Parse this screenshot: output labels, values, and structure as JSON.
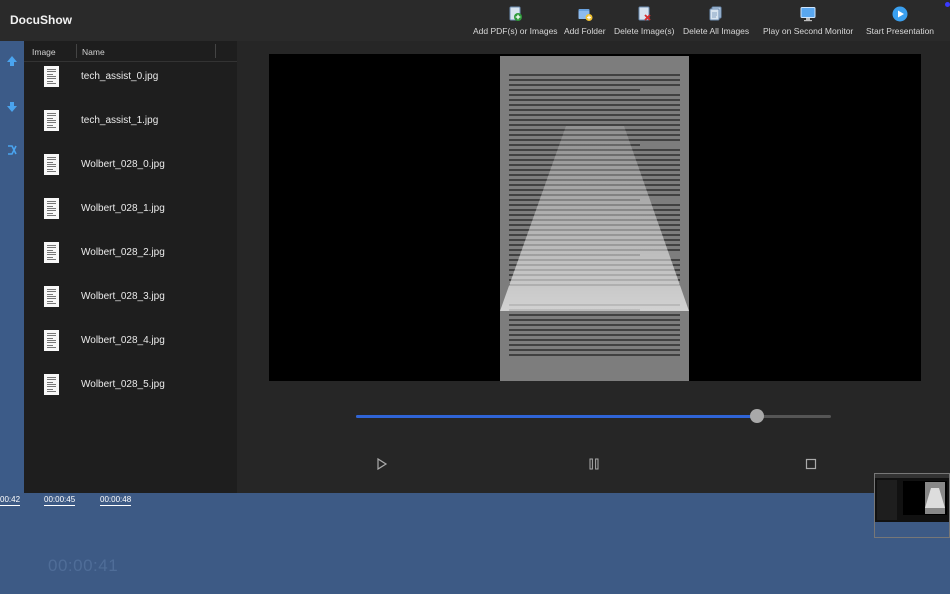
{
  "app": {
    "title": "DocuShow"
  },
  "toolbar": {
    "buttons": [
      {
        "label": "Add PDF(s) or Images",
        "icon": "add-file-icon"
      },
      {
        "label": "Add Folder",
        "icon": "add-folder-icon"
      },
      {
        "label": "Delete Image(s)",
        "icon": "delete-image-icon"
      },
      {
        "label": "Delete All Images",
        "icon": "delete-all-icon"
      },
      {
        "label": "Play on Second Monitor",
        "icon": "monitor-icon"
      },
      {
        "label": "Start Presentation",
        "icon": "play-circle-icon"
      }
    ]
  },
  "list": {
    "headers": {
      "image": "Image",
      "name": "Name"
    },
    "rows": [
      {
        "name": "tech_assist_0.jpg"
      },
      {
        "name": "tech_assist_1.jpg"
      },
      {
        "name": "Wolbert_028_0.jpg"
      },
      {
        "name": "Wolbert_028_1.jpg"
      },
      {
        "name": "Wolbert_028_2.jpg"
      },
      {
        "name": "Wolbert_028_3.jpg"
      },
      {
        "name": "Wolbert_028_4.jpg"
      },
      {
        "name": "Wolbert_028_5.jpg"
      }
    ]
  },
  "player": {
    "progress": 0.845
  },
  "timeline": {
    "labels": [
      "00:42",
      "00:00:45",
      "00:00:48"
    ],
    "current_time": "00:00:41"
  },
  "colors": {
    "accent": "#2f64d6",
    "background": "#3d5a85"
  }
}
